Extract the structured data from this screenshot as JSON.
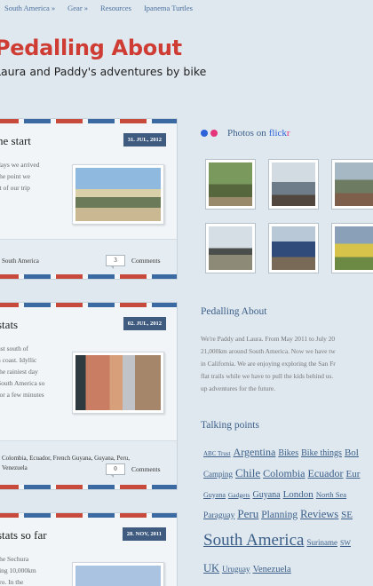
{
  "nav": {
    "items": [
      "South America »",
      "Gear »",
      "Resources",
      "Ipanema Turtles"
    ]
  },
  "header": {
    "title": "Pedalling About",
    "tagline": "Laura and Paddy's adventures by bike"
  },
  "posts": [
    {
      "title": "he start",
      "date": "31. JUL, 2012",
      "text_lines": [
        "days we arrived",
        "the point we",
        "rt of our trip"
      ],
      "tags_lines": [
        "South America"
      ],
      "comments_count": "3",
      "comments_label": "Comments"
    },
    {
      "title": "stats",
      "date": "02. JUL, 2012",
      "text_lines": [
        "ust south of",
        "n coast. Idyllic",
        "the rainiest day",
        "South America so",
        "for a few minutes"
      ],
      "tags_lines": [
        "Colombia, Ecuador, French Guyana, Guyana, Peru,",
        "Venezuela"
      ],
      "comments_count": "0",
      "comments_label": "Comments"
    },
    {
      "title": "stats so far",
      "date": "28. NOV, 2011",
      "text_lines": [
        "the Sechura",
        "ling 10,000km",
        "iro. In the"
      ]
    }
  ],
  "sidebar": {
    "flickr": {
      "heading_prefix": "Photos on",
      "brand": "flick",
      "brand_r": "r",
      "photos": [
        "flickr-photo-1",
        "flickr-photo-2",
        "flickr-photo-3",
        "flickr-photo-4",
        "flickr-photo-5",
        "flickr-photo-6"
      ]
    },
    "about": {
      "title": "Pedalling About",
      "lines": [
        "We're Paddy and Laura. From May 2011 to July 20",
        "21,000km around South America. Now we have tw",
        "in California. We are enjoying exploring the San Fr",
        "flat trails while we have to pull the kids behind us.",
        "up adventures for the future."
      ]
    },
    "talking_points": {
      "title": "Talking points",
      "rows": [
        [
          {
            "t": "ABC Trust",
            "s": 7
          },
          {
            "t": "Argentina",
            "s": 12
          },
          {
            "t": "Bikes",
            "s": 10
          },
          {
            "t": "Bike things",
            "s": 10
          },
          {
            "t": "Bol",
            "s": 11
          }
        ],
        [
          {
            "t": "Camping",
            "s": 9
          },
          {
            "t": "Chile",
            "s": 13
          },
          {
            "t": "Colombia",
            "s": 12
          },
          {
            "t": "Ecuador",
            "s": 12
          },
          {
            "t": "Eur",
            "s": 11
          }
        ],
        [
          {
            "t": "Guyana",
            "s": 8
          },
          {
            "t": "Gadgets",
            "s": 7.5
          },
          {
            "t": "Guyana",
            "s": 10
          },
          {
            "t": "London",
            "s": 11
          },
          {
            "t": "North Sea",
            "s": 8.5
          }
        ],
        [
          {
            "t": "Paraguay",
            "s": 9.5
          },
          {
            "t": "Peru",
            "s": 13
          },
          {
            "t": "Planning",
            "s": 11.5
          },
          {
            "t": "Reviews",
            "s": 12.5
          },
          {
            "t": "SE",
            "s": 11
          }
        ],
        [
          {
            "t": "South America",
            "s": 19
          },
          {
            "t": "Suriname",
            "s": 9
          },
          {
            "t": "SW",
            "s": 8
          }
        ],
        [
          {
            "t": "UK",
            "s": 12.5
          },
          {
            "t": "Uruguay",
            "s": 9
          },
          {
            "t": "Venezuela",
            "s": 10.5
          }
        ]
      ]
    }
  },
  "colors": {
    "title": "#cf3c34",
    "link": "#3b5f88",
    "date_badge": "#3f5b80",
    "flickr_blue": "#2c63d8",
    "flickr_pink": "#e5357a"
  }
}
